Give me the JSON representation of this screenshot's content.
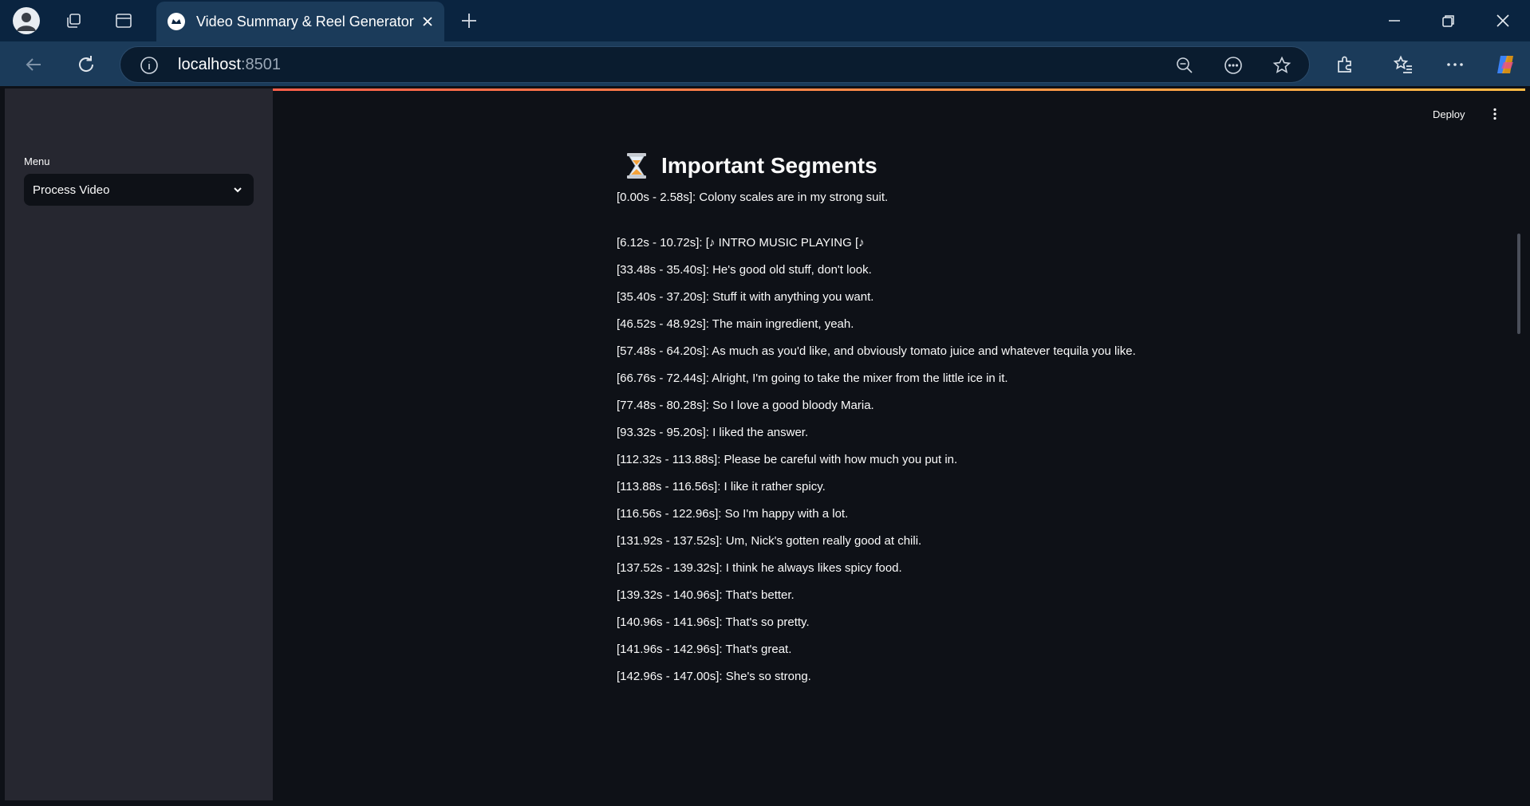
{
  "browser": {
    "tab_title": "Video Summary & Reel Generator",
    "url_host": "localhost",
    "url_port": ":8501"
  },
  "app": {
    "deploy_label": "Deploy"
  },
  "sidebar": {
    "menu_label": "Menu",
    "select_value": "Process Video"
  },
  "main": {
    "heading": "Important Segments",
    "segments": [
      "[0.00s - 2.58s]: Colony scales are in my strong suit.",
      "[6.12s - 10.72s]: [♪ INTRO MUSIC PLAYING [♪",
      "[33.48s - 35.40s]: He's good old stuff, don't look.",
      "[35.40s - 37.20s]: Stuff it with anything you want.",
      "[46.52s - 48.92s]: The main ingredient, yeah.",
      "[57.48s - 64.20s]: As much as you'd like, and obviously tomato juice and whatever tequila you like.",
      "[66.76s - 72.44s]: Alright, I'm going to take the mixer from the little ice in it.",
      "[77.48s - 80.28s]: So I love a good bloody Maria.",
      "[93.32s - 95.20s]: I liked the answer.",
      "[112.32s - 113.88s]: Please be careful with how much you put in.",
      "[113.88s - 116.56s]: I like it rather spicy.",
      "[116.56s - 122.96s]: So I'm happy with a lot.",
      "[131.92s - 137.52s]: Um, Nick's gotten really good at chili.",
      "[137.52s - 139.32s]: I think he always likes spicy food.",
      "[139.32s - 140.96s]: That's better.",
      "[140.96s - 141.96s]: That's so pretty.",
      "[141.96s - 142.96s]: That's great.",
      "[142.96s - 147.00s]: She's so strong."
    ]
  }
}
